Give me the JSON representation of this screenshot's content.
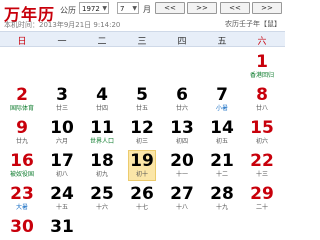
{
  "header": {
    "brand": "万年历",
    "current_time_prefix": "本机时间：",
    "current_time": "2013年9月21日 9:14:20",
    "calendar_label": "公历",
    "year_select": "1972",
    "month_select": "7",
    "month_label": "月",
    "nav_buttons": [
      "<<",
      ">>",
      "<<",
      ">>"
    ],
    "lunar_info": "农历壬子年【鼠】"
  },
  "weekdays": [
    "日",
    "一",
    "二",
    "三",
    "四",
    "五",
    "六"
  ],
  "today_day": "19",
  "rows": [
    [
      {
        "day": "",
        "lunar": ""
      },
      {
        "day": "",
        "lunar": ""
      },
      {
        "day": "",
        "lunar": ""
      },
      {
        "day": "",
        "lunar": ""
      },
      {
        "day": "",
        "lunar": ""
      },
      {
        "day": "",
        "lunar": ""
      },
      {
        "day": "1",
        "lunar": "香港回归",
        "type": "fest",
        "red": true
      }
    ],
    [
      {
        "day": "2",
        "lunar": "国际体育",
        "type": "fest",
        "red": true
      },
      {
        "day": "3",
        "lunar": "廿三"
      },
      {
        "day": "4",
        "lunar": "廿四"
      },
      {
        "day": "5",
        "lunar": "廿五"
      },
      {
        "day": "6",
        "lunar": "廿六"
      },
      {
        "day": "7",
        "lunar": "小暑",
        "type": "term"
      },
      {
        "day": "8",
        "lunar": "廿八",
        "red": true
      }
    ],
    [
      {
        "day": "9",
        "lunar": "廿九",
        "red": true
      },
      {
        "day": "10",
        "lunar": "六月"
      },
      {
        "day": "11",
        "lunar": "世界人口",
        "type": "fest"
      },
      {
        "day": "12",
        "lunar": "初三"
      },
      {
        "day": "13",
        "lunar": "初四"
      },
      {
        "day": "14",
        "lunar": "初五"
      },
      {
        "day": "15",
        "lunar": "初六",
        "red": true
      }
    ],
    [
      {
        "day": "16",
        "lunar": "被奴役国",
        "type": "fest",
        "red": true
      },
      {
        "day": "17",
        "lunar": "初八"
      },
      {
        "day": "18",
        "lunar": "初九"
      },
      {
        "day": "19",
        "lunar": "初十"
      },
      {
        "day": "20",
        "lunar": "十一"
      },
      {
        "day": "21",
        "lunar": "十二"
      },
      {
        "day": "22",
        "lunar": "十三",
        "red": true
      }
    ],
    [
      {
        "day": "23",
        "lunar": "大暑",
        "type": "term",
        "red": true
      },
      {
        "day": "24",
        "lunar": "十五"
      },
      {
        "day": "25",
        "lunar": "十六"
      },
      {
        "day": "26",
        "lunar": "十七"
      },
      {
        "day": "27",
        "lunar": "十八"
      },
      {
        "day": "28",
        "lunar": "十九"
      },
      {
        "day": "29",
        "lunar": "二十",
        "red": true
      }
    ],
    [
      {
        "day": "30",
        "lunar": "",
        "red": true
      },
      {
        "day": "31",
        "lunar": ""
      },
      {
        "day": "",
        "lunar": ""
      },
      {
        "day": "",
        "lunar": ""
      },
      {
        "day": "",
        "lunar": ""
      },
      {
        "day": "",
        "lunar": ""
      },
      {
        "day": "",
        "lunar": ""
      }
    ]
  ]
}
